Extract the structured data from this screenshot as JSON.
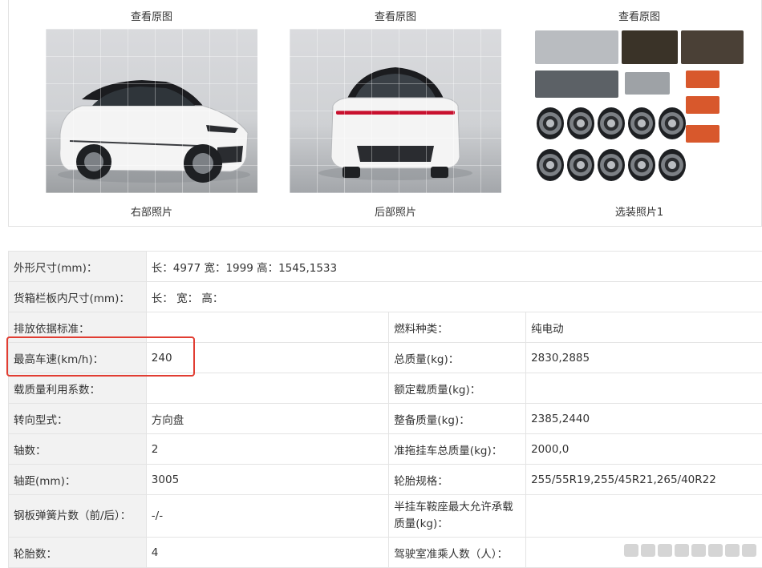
{
  "gallery": {
    "photos": [
      {
        "link": "查看原图",
        "caption": "右部照片"
      },
      {
        "link": "查看原图",
        "caption": "后部照片"
      },
      {
        "link": "查看原图",
        "caption": "选装照片1"
      }
    ]
  },
  "spec_table": {
    "rows": [
      {
        "label": "外形尺寸(mm)：",
        "value": "长：4977 宽：1999 高：1545,1533"
      },
      {
        "label": "货箱栏板内尺寸(mm)：",
        "value": "长： 宽： 高："
      },
      {
        "label": "排放依据标准：",
        "value": "",
        "label2": "燃料种类：",
        "value2": "纯电动"
      },
      {
        "label": "最高车速(km/h)：",
        "value": "240",
        "label2": "总质量(kg)：",
        "value2": "2830,2885"
      },
      {
        "label": "载质量利用系数：",
        "value": "",
        "label2": "额定载质量(kg)：",
        "value2": ""
      },
      {
        "label": "转向型式：",
        "value": "方向盘",
        "label2": "整备质量(kg)：",
        "value2": "2385,2440"
      },
      {
        "label": "轴数：",
        "value": "2",
        "label2": "准拖挂车总质量(kg)：",
        "value2": "2000,0"
      },
      {
        "label": "轴距(mm)：",
        "value": "3005",
        "label2": "轮胎规格：",
        "value2": "255/55R19,255/45R21,265/40R22"
      },
      {
        "label": "钢板弹簧片数（前/后）：",
        "value": "-/-",
        "label2": "半挂车鞍座最大允许承载质量(kg)：",
        "value2": ""
      },
      {
        "label": "轮胎数：",
        "value": "4",
        "label2": "驾驶室准乘人数（人）：",
        "value2": ""
      }
    ]
  },
  "colors": {
    "highlight": "#e13d32",
    "label_bg": "#f2f2f2",
    "car_body": "#f4f4f4",
    "taillight": "#c8102e"
  }
}
